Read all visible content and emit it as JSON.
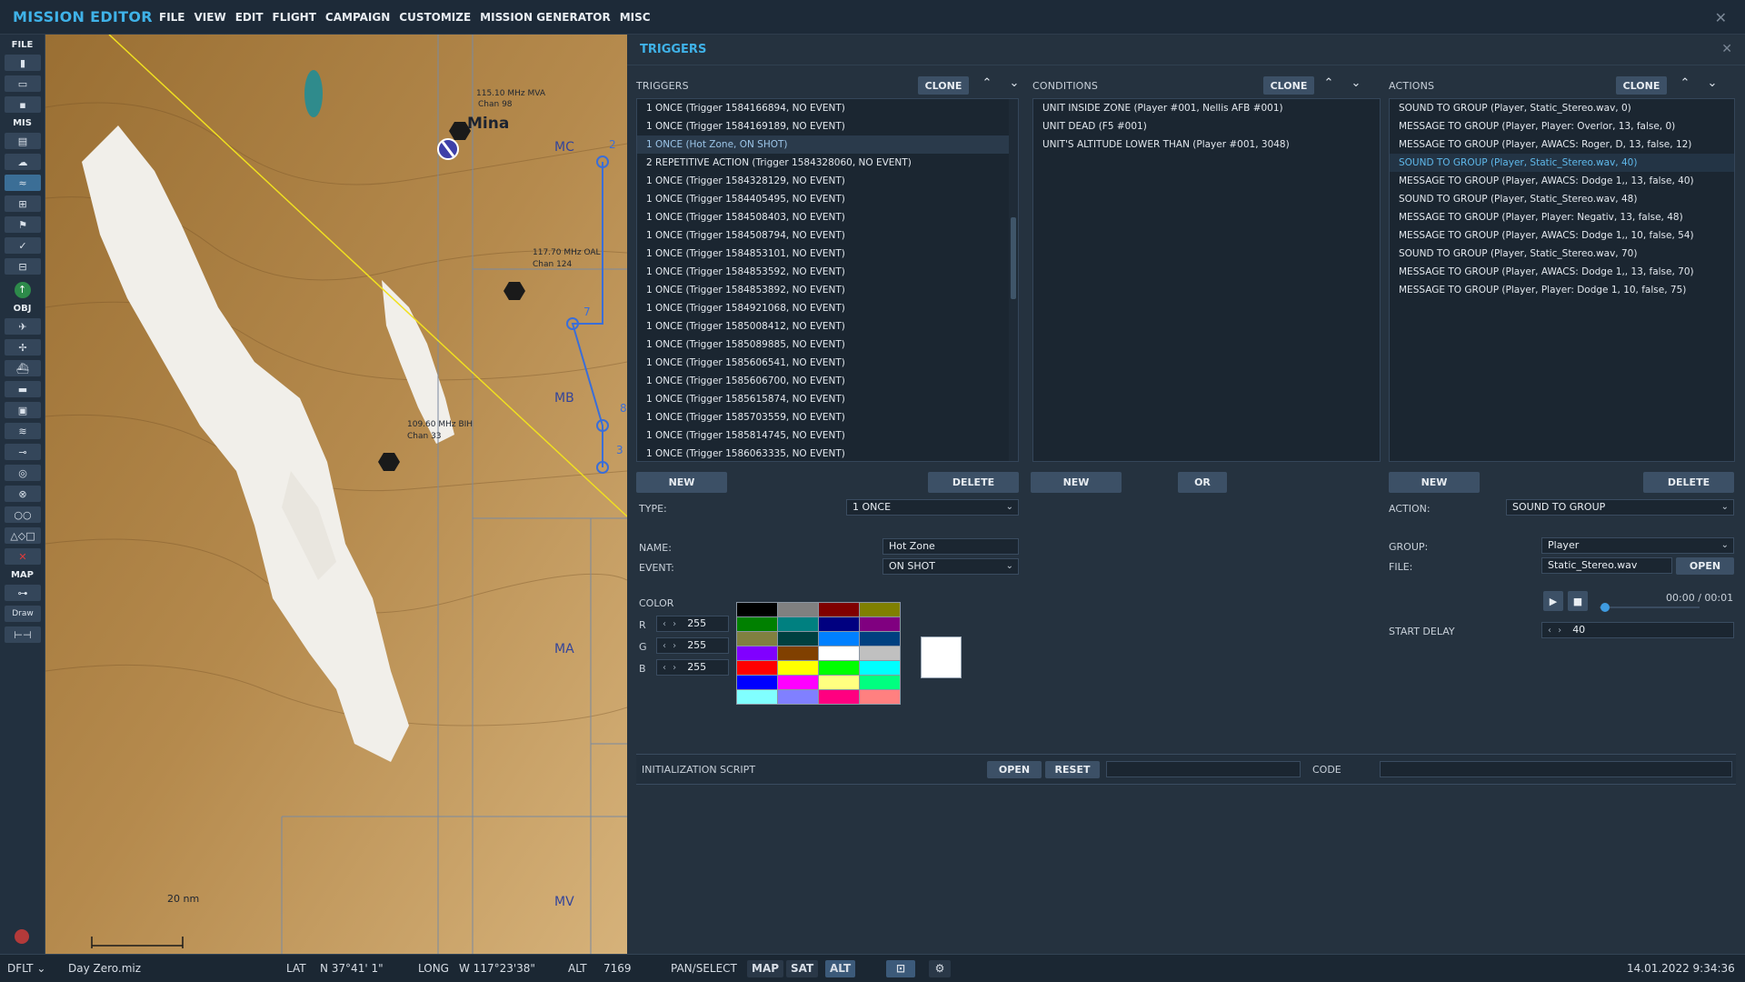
{
  "app": {
    "title": "MISSION EDITOR"
  },
  "menu": [
    "FILE",
    "VIEW",
    "EDIT",
    "FLIGHT",
    "CAMPAIGN",
    "CUSTOMIZE",
    "MISSION GENERATOR",
    "MISC"
  ],
  "left_tools": {
    "file_label": "FILE",
    "mis_label": "MIS",
    "obj_label": "OBJ",
    "map_label": "MAP",
    "draw_label": "Draw"
  },
  "map": {
    "city": "Mina",
    "navaids": [
      {
        "freq": "115.10 MHz MVA",
        "chan": "Chan 98"
      },
      {
        "freq": "117.70 MHz OAL",
        "chan": "Chan 124"
      },
      {
        "freq": "109.60 MHz BIH",
        "chan": "Chan 33"
      }
    ],
    "regions": [
      "MC",
      "MB",
      "MA",
      "MV"
    ],
    "waypoints": [
      "2",
      "7",
      "8",
      "3"
    ],
    "scale": "20 nm"
  },
  "panel": {
    "title": "TRIGGERS"
  },
  "triggers": {
    "header": "TRIGGERS",
    "clone": "CLONE",
    "items": [
      "1 ONCE (Trigger 1584166894, NO EVENT)",
      "1 ONCE (Trigger 1584169189, NO EVENT)",
      "1 ONCE (Hot Zone, ON SHOT)",
      "2 REPETITIVE ACTION (Trigger 1584328060, NO EVENT)",
      "1 ONCE (Trigger 1584328129, NO EVENT)",
      "1 ONCE (Trigger 1584405495, NO EVENT)",
      "1 ONCE (Trigger 1584508403, NO EVENT)",
      "1 ONCE (Trigger 1584508794, NO EVENT)",
      "1 ONCE (Trigger 1584853101, NO EVENT)",
      "1 ONCE (Trigger 1584853592, NO EVENT)",
      "1 ONCE (Trigger 1584853892, NO EVENT)",
      "1 ONCE (Trigger 1584921068, NO EVENT)",
      "1 ONCE (Trigger 1585008412, NO EVENT)",
      "1 ONCE (Trigger 1585089885, NO EVENT)",
      "1 ONCE (Trigger 1585606541, NO EVENT)",
      "1 ONCE (Trigger 1585606700, NO EVENT)",
      "1 ONCE (Trigger 1585615874, NO EVENT)",
      "1 ONCE (Trigger 1585703559, NO EVENT)",
      "1 ONCE (Trigger 1585814745, NO EVENT)",
      "1 ONCE (Trigger 1586063335, NO EVENT)"
    ],
    "new": "NEW",
    "delete": "DELETE"
  },
  "conditions": {
    "header": "CONDITIONS",
    "clone": "CLONE",
    "items": [
      "UNIT INSIDE ZONE (Player #001, Nellis AFB #001)",
      "UNIT DEAD (F5 #001)",
      "UNIT'S ALTITUDE LOWER THAN (Player #001, 3048)"
    ],
    "new": "NEW",
    "or": "OR"
  },
  "actions": {
    "header": "ACTIONS",
    "clone": "CLONE",
    "items": [
      "SOUND TO GROUP (Player, Static_Stereo.wav, 0)",
      "MESSAGE TO GROUP (Player, Player: Overlor, 13, false, 0)",
      "MESSAGE TO GROUP (Player, AWACS: Roger, D, 13, false, 12)",
      "SOUND TO GROUP (Player, Static_Stereo.wav, 40)",
      "MESSAGE TO GROUP (Player, AWACS: Dodge 1,, 13, false, 40)",
      "SOUND TO GROUP (Player, Static_Stereo.wav, 48)",
      "MESSAGE TO GROUP (Player, Player: Negativ, 13, false, 48)",
      "MESSAGE TO GROUP (Player, AWACS: Dodge 1,, 10, false, 54)",
      "SOUND TO GROUP (Player, Static_Stereo.wav, 70)",
      "MESSAGE TO GROUP (Player, AWACS: Dodge 1,, 13, false, 70)",
      "MESSAGE TO GROUP (Player, Player: Dodge 1, 10, false, 75)"
    ],
    "new": "NEW",
    "delete": "DELETE"
  },
  "trigger_props": {
    "type_label": "TYPE:",
    "type_value": "1 ONCE",
    "name_label": "NAME:",
    "name_value": "Hot Zone",
    "event_label": "EVENT:",
    "event_value": "ON SHOT",
    "color_label": "COLOR",
    "r_label": "R",
    "r_value": "255",
    "g_label": "G",
    "g_value": "255",
    "b_label": "B",
    "b_value": "255",
    "palette": [
      "#000000",
      "#808080",
      "#800000",
      "#808000",
      "#008000",
      "#008080",
      "#000080",
      "#800080",
      "#808040",
      "#004040",
      "#0080ff",
      "#004080",
      "#8000ff",
      "#804000",
      "#ffffff",
      "#c0c0c0",
      "#ff0000",
      "#ffff00",
      "#00ff00",
      "#00ffff",
      "#0000ff",
      "#ff00ff",
      "#ffff80",
      "#00ff80",
      "#80ffff",
      "#8080ff",
      "#ff0080",
      "#ff8080"
    ],
    "preview_color": "#ffffff"
  },
  "action_props": {
    "action_label": "ACTION:",
    "action_value": "SOUND TO GROUP",
    "group_label": "GROUP:",
    "group_value": "Player",
    "file_label": "FILE:",
    "file_value": "Static_Stereo.wav",
    "open": "OPEN",
    "time": "00:00 / 00:01",
    "start_delay_label": "START DELAY",
    "start_delay_value": "40"
  },
  "init_script": {
    "label": "INITIALIZATION SCRIPT",
    "open": "OPEN",
    "reset": "RESET",
    "code_label": "CODE"
  },
  "status": {
    "profile": "DFLT",
    "file": "Day Zero.miz",
    "lat_label": "LAT",
    "lat": "N 37°41' 1\"",
    "long_label": "LONG",
    "long": "W 117°23'38\"",
    "alt_label": "ALT",
    "alt": "7169",
    "mode": "PAN/SELECT",
    "map": "MAP",
    "sat": "SAT",
    "alt_btn": "ALT",
    "datetime": "14.01.2022 9:34:36"
  }
}
